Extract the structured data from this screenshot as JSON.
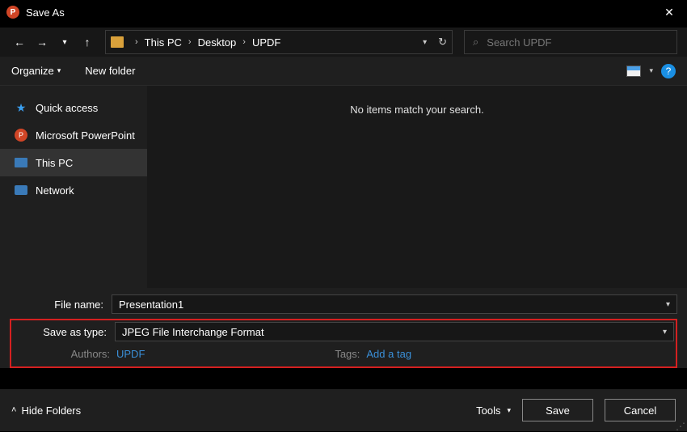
{
  "title": "Save As",
  "breadcrumb": [
    "This PC",
    "Desktop",
    "UPDF"
  ],
  "search_placeholder": "Search UPDF",
  "toolbar": {
    "organize": "Organize",
    "newfolder": "New folder"
  },
  "sidebar": {
    "items": [
      {
        "label": "Quick access"
      },
      {
        "label": "Microsoft PowerPoint"
      },
      {
        "label": "This PC"
      },
      {
        "label": "Network"
      }
    ]
  },
  "content_empty": "No items match your search.",
  "form": {
    "filename_label": "File name:",
    "filename_value": "Presentation1",
    "type_label": "Save as type:",
    "type_value": "JPEG File Interchange Format",
    "authors_label": "Authors:",
    "authors_value": "UPDF",
    "tags_label": "Tags:",
    "tags_value": "Add a tag"
  },
  "footer": {
    "hide": "Hide Folders",
    "tools": "Tools",
    "save": "Save",
    "cancel": "Cancel"
  }
}
